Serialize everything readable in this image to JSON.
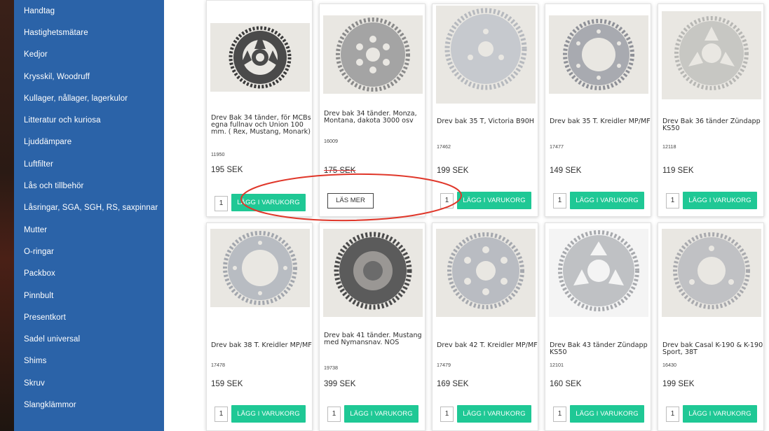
{
  "sidebar": {
    "items": [
      {
        "label": "Handtag"
      },
      {
        "label": "Hastighetsmätare"
      },
      {
        "label": "Kedjor"
      },
      {
        "label": "Krysskil, Woodruff"
      },
      {
        "label": "Kullager, nållager, lagerkulor"
      },
      {
        "label": "Litteratur och kuriosa"
      },
      {
        "label": "Ljuddämpare"
      },
      {
        "label": "Luftfilter"
      },
      {
        "label": "Lås och tillbehör"
      },
      {
        "label": "Låsringar, SGA, SGH, RS, saxpinnar"
      },
      {
        "label": "Mutter"
      },
      {
        "label": "O-ringar"
      },
      {
        "label": "Packbox"
      },
      {
        "label": "Pinnbult"
      },
      {
        "label": "Presentkort"
      },
      {
        "label": "Sadel universal"
      },
      {
        "label": "Shims"
      },
      {
        "label": "Skruv"
      },
      {
        "label": "Slangklämmor"
      }
    ]
  },
  "products": [
    {
      "title": "Drev Bak 34 tänder, för MCBs egna fullnav och Union 100 mm. ( Rex, Mustang, Monark)",
      "sku": "11950",
      "price": "195 SEK",
      "qty": "1",
      "button": "LÄGG I VARUKORG"
    },
    {
      "title": "Drev bak 34 tänder. Monza, Montana, dakota 3000 osv",
      "sku": "16009",
      "price": "175 SEK",
      "button": "LÄS MER"
    },
    {
      "title": "Drev bak 35 T, Victoria B90H",
      "sku": "17462",
      "price": "199 SEK",
      "qty": "1",
      "button": "LÄGG I VARUKORG"
    },
    {
      "title": "Drev bak 35 T. Kreidler MP/MF",
      "sku": "17477",
      "price": "149 SEK",
      "qty": "1",
      "button": "LÄGG I VARUKORG"
    },
    {
      "title": "Drev Bak 36 tänder Zündapp KS50",
      "sku": "12118",
      "price": "119 SEK",
      "qty": "1",
      "button": "LÄGG I VARUKORG"
    },
    {
      "title": "Drev bak 38 T. Kreidler MP/MF",
      "sku": "17478",
      "price": "159 SEK",
      "qty": "1",
      "button": "LÄGG I VARUKORG"
    },
    {
      "title": "Drev bak 41 tänder. Mustang med Nymansnav. NOS",
      "sku": "19738",
      "price": "399 SEK",
      "qty": "1",
      "button": "LÄGG I VARUKORG"
    },
    {
      "title": "Drev bak 42 T. Kreidler MP/MF",
      "sku": "17479",
      "price": "169 SEK",
      "qty": "1",
      "button": "LÄGG I VARUKORG"
    },
    {
      "title": "Drev Bak 43 tänder Zündapp KS50",
      "sku": "12101",
      "price": "160 SEK",
      "qty": "1",
      "button": "LÄGG I VARUKORG"
    },
    {
      "title": "Drev bak Casal K-190 & K-190 Sport, 38T",
      "sku": "16430",
      "price": "199 SEK",
      "qty": "1",
      "button": "LÄGG I VARUKORG"
    }
  ],
  "colors": {
    "sidebar_bg": "#2b63a8",
    "add_button": "#1fc895",
    "annotation": "#e0372a"
  }
}
